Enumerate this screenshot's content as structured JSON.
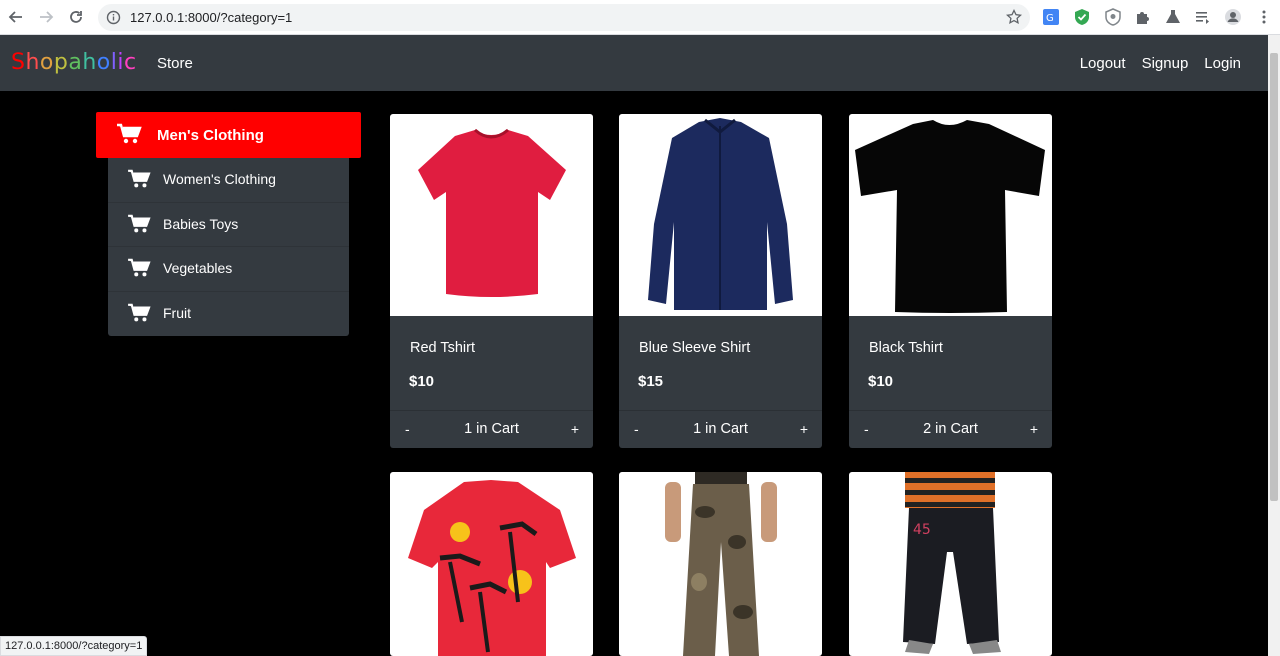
{
  "browser": {
    "url": "127.0.0.1:8000/?category=1",
    "status_url": "127.0.0.1:8000/?category=1"
  },
  "navbar": {
    "brand_letters": [
      "S",
      "h",
      "o",
      "p",
      "a",
      "h",
      "o",
      "l",
      "i",
      "c"
    ],
    "brand_colors": [
      "#ff0000",
      "#ff4d4d",
      "#e0a040",
      "#c0c040",
      "#60c060",
      "#40c0a0",
      "#4080ff",
      "#8060ff",
      "#c040ff",
      "#ff40c0"
    ],
    "store": "Store",
    "logout": "Logout",
    "signup": "Signup",
    "login": "Login"
  },
  "categories": {
    "active": "Men's Clothing",
    "items": [
      {
        "label": "Women's Clothing"
      },
      {
        "label": "Babies Toys"
      },
      {
        "label": "Vegetables"
      },
      {
        "label": "Fruit"
      }
    ]
  },
  "products": [
    {
      "name": "Red Tshirt",
      "price": "$10",
      "minus": "-",
      "plus": "+",
      "qty": "1 in Cart",
      "image": "red-tshirt"
    },
    {
      "name": "Blue Sleeve Shirt",
      "price": "$15",
      "minus": "-",
      "plus": "+",
      "qty": "1 in Cart",
      "image": "blue-sleeve-shirt"
    },
    {
      "name": "Black Tshirt",
      "price": "$10",
      "minus": "-",
      "plus": "+",
      "qty": "2 in Cart",
      "image": "black-tshirt"
    },
    {
      "image": "hawaiian-shirt"
    },
    {
      "image": "camo-pants"
    },
    {
      "image": "black-joggers"
    }
  ],
  "colors": {
    "accent": "#ff0000",
    "panel": "#343a40",
    "background": "#000000"
  }
}
